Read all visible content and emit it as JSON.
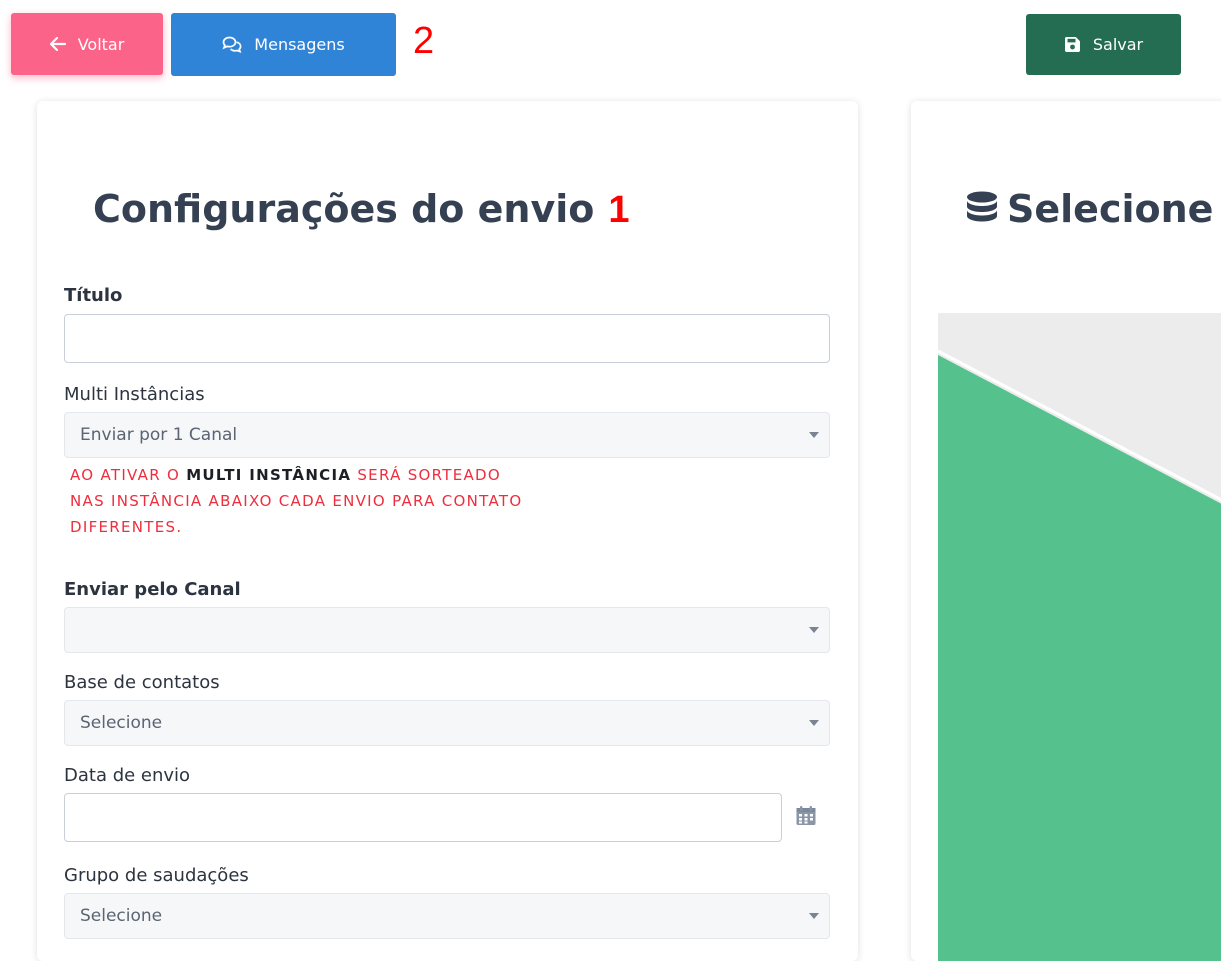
{
  "toolbar": {
    "back_label": "Voltar",
    "messages_label": "Mensagens",
    "save_label": "Salvar"
  },
  "annotations": {
    "one": "1",
    "two": "2"
  },
  "left_card": {
    "title": "Configurações do envio",
    "fields": {
      "titulo_label": "Título",
      "titulo_value": "",
      "multi_label": "Multi Instâncias",
      "multi_value": "Enviar por 1 Canal",
      "canal_label": "Enviar pelo Canal",
      "canal_value": "",
      "base_label": "Base de contatos",
      "base_value": "Selecione",
      "data_label": "Data de envio",
      "data_value": "",
      "grupo_label": "Grupo de saudações",
      "grupo_value": "Selecione"
    },
    "warning": {
      "part1": " AO ATIVAR O ",
      "highlight": "MULTI INSTÂNCIA",
      "part2": " SERÁ SORTEADO",
      "line2": "NAS INSTÂNCIA ABAIXO CADA ENVIO PARA CONTATO",
      "line3": "DIFERENTES."
    }
  },
  "right_card": {
    "title": "Selecione"
  },
  "colors": {
    "back_button": "#fb6388",
    "messages_button": "#2f84d8",
    "save_button": "#246d53",
    "warning_text": "#ee2e3d",
    "annotation": "#ff0000",
    "illustration_green": "#55c28d"
  },
  "icons": {
    "back": "arrow-left-icon",
    "messages": "chat-bubbles-icon",
    "save": "floppy-disk-icon",
    "calendar": "calendar-icon",
    "database": "database-icon",
    "dropdown": "chevron-down-icon"
  }
}
